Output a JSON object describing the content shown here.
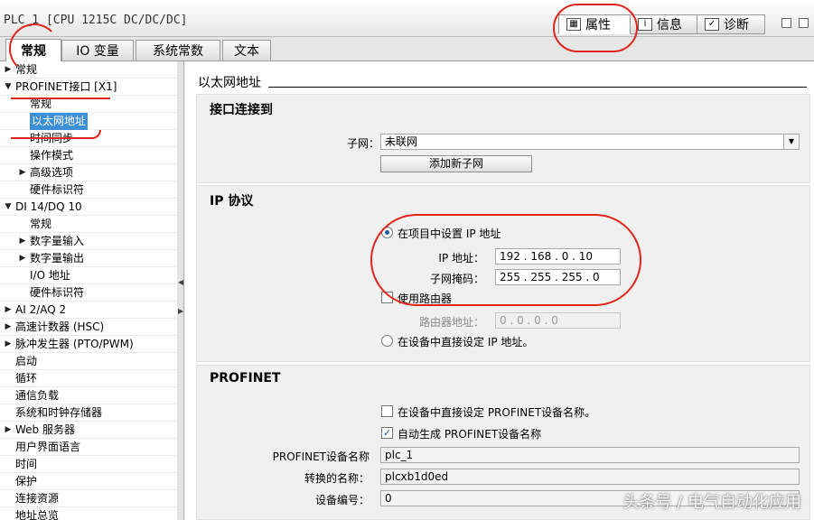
{
  "titlebar": {
    "title": "PLC_1 [CPU 1215C DC/DC/DC]",
    "tabs": [
      "属性",
      "信息",
      "诊断"
    ]
  },
  "tabs": [
    "常规",
    "IO 变量",
    "系统常数",
    "文本"
  ],
  "tree": [
    {
      "label": "常规",
      "level": 0,
      "arrow": "right"
    },
    {
      "label": "PROFINET接口 [X1]",
      "level": 0,
      "arrow": "down"
    },
    {
      "label": "常规",
      "level": 1,
      "arrow": ""
    },
    {
      "label": "以太网地址",
      "level": 1,
      "arrow": "",
      "selected": true
    },
    {
      "label": "时间同步",
      "level": 1,
      "arrow": ""
    },
    {
      "label": "操作模式",
      "level": 1,
      "arrow": ""
    },
    {
      "label": "高级选项",
      "level": 1,
      "arrow": "right"
    },
    {
      "label": "硬件标识符",
      "level": 1,
      "arrow": ""
    },
    {
      "label": "DI 14/DQ 10",
      "level": 0,
      "arrow": "down"
    },
    {
      "label": "常规",
      "level": 1,
      "arrow": ""
    },
    {
      "label": "数字量输入",
      "level": 1,
      "arrow": "right"
    },
    {
      "label": "数字量输出",
      "level": 1,
      "arrow": "right"
    },
    {
      "label": "I/O 地址",
      "level": 1,
      "arrow": ""
    },
    {
      "label": "硬件标识符",
      "level": 1,
      "arrow": ""
    },
    {
      "label": "AI 2/AQ 2",
      "level": 0,
      "arrow": "right"
    },
    {
      "label": "高速计数器 (HSC)",
      "level": 0,
      "arrow": "right"
    },
    {
      "label": "脉冲发生器 (PTO/PWM)",
      "level": 0,
      "arrow": "right"
    },
    {
      "label": "启动",
      "level": 0,
      "arrow": ""
    },
    {
      "label": "循环",
      "level": 0,
      "arrow": ""
    },
    {
      "label": "通信负载",
      "level": 0,
      "arrow": ""
    },
    {
      "label": "系统和时钟存储器",
      "level": 0,
      "arrow": ""
    },
    {
      "label": "Web 服务器",
      "level": 0,
      "arrow": "right"
    },
    {
      "label": "用户界面语言",
      "level": 0,
      "arrow": ""
    },
    {
      "label": "时间",
      "level": 0,
      "arrow": ""
    },
    {
      "label": "保护",
      "level": 0,
      "arrow": ""
    },
    {
      "label": "连接资源",
      "level": 0,
      "arrow": ""
    },
    {
      "label": "地址总览",
      "level": 0,
      "arrow": ""
    }
  ],
  "content": {
    "section_title": "以太网地址",
    "interface": {
      "title": "接口连接到",
      "subnet_label": "子网：",
      "subnet_value": "未联网",
      "add_subnet_button": "添加新子网"
    },
    "ip": {
      "title": "IP 协议",
      "opt_project": "在项目中设置 IP 地址",
      "ip_label": "IP 地址：",
      "ip_value": "192 . 168 .  0   . 10",
      "mask_label": "子网掩码：",
      "mask_value": "255 . 255 . 255 . 0",
      "use_router": "使用路由器",
      "router_label": "路由器地址：",
      "router_value": "0   .  0   .  0   .  0",
      "opt_device": "在设备中直接设定 IP 地址。"
    },
    "profinet": {
      "title": "PROFINET",
      "opt_direct": "在设备中直接设定 PROFINET设备名称。",
      "opt_auto": "自动生成 PROFINET设备名称",
      "name_label": "PROFINET设备名称",
      "name_value": "plc_1",
      "converted_label": "转换的名称：",
      "converted_value": "plcxb1d0ed",
      "devno_label": "设备编号：",
      "devno_value": "0"
    }
  },
  "watermark": "头条号 / 电气自动化应用",
  "colors": {
    "selection": "#3d8fd6",
    "annotation": "#e0261c"
  }
}
